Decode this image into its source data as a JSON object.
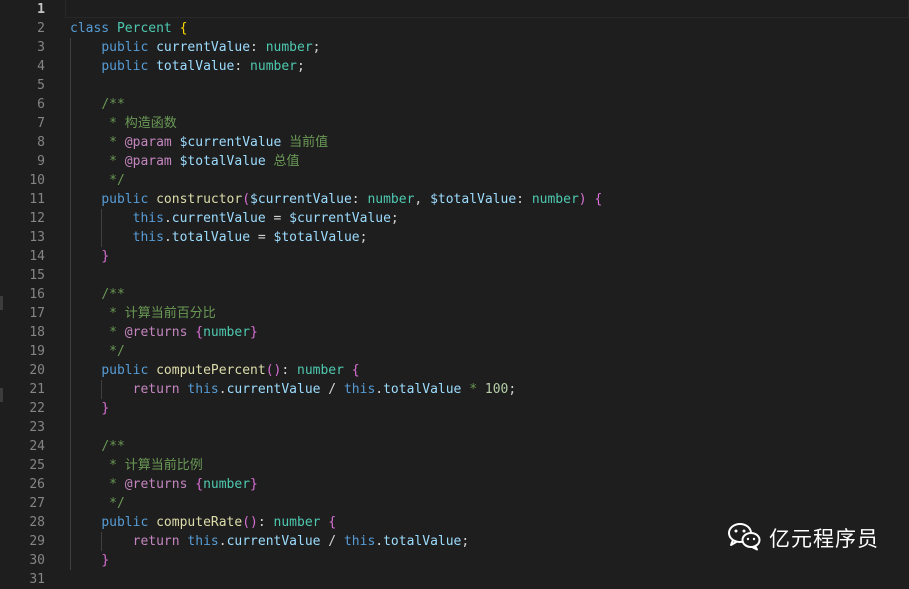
{
  "editor": {
    "active_line": "1",
    "lines": [
      {
        "n": "1"
      },
      {
        "n": "2",
        "t": [
          "class",
          " ",
          "Percent",
          " ",
          "{"
        ]
      },
      {
        "n": "3",
        "t": [
          "    ",
          "public",
          " ",
          "currentValue",
          ": ",
          "number",
          ";"
        ]
      },
      {
        "n": "4",
        "t": [
          "    ",
          "public",
          " ",
          "totalValue",
          ": ",
          "number",
          ";"
        ]
      },
      {
        "n": "5"
      },
      {
        "n": "6",
        "t": [
          "    ",
          "/**"
        ]
      },
      {
        "n": "7",
        "t": [
          "     * 构造函数"
        ]
      },
      {
        "n": "8",
        "t": [
          "     * ",
          "@param",
          " ",
          "$currentValue",
          " 当前值"
        ]
      },
      {
        "n": "9",
        "t": [
          "     * ",
          "@param",
          " ",
          "$totalValue",
          " 总值"
        ]
      },
      {
        "n": "10",
        "t": [
          "     */"
        ]
      },
      {
        "n": "11",
        "t": [
          "    ",
          "public",
          " ",
          "constructor",
          "(",
          "$currentValue",
          ": ",
          "number",
          ", ",
          "$totalValue",
          ": ",
          "number",
          ")",
          " ",
          "{"
        ]
      },
      {
        "n": "12",
        "t": [
          "        ",
          "this",
          ".",
          "currentValue",
          " = ",
          "$currentValue",
          ";"
        ]
      },
      {
        "n": "13",
        "t": [
          "        ",
          "this",
          ".",
          "totalValue",
          " = ",
          "$totalValue",
          ";"
        ]
      },
      {
        "n": "14",
        "t": [
          "    ",
          "}"
        ]
      },
      {
        "n": "15"
      },
      {
        "n": "16",
        "t": [
          "    ",
          "/**"
        ]
      },
      {
        "n": "17",
        "t": [
          "     * 计算当前百分比"
        ]
      },
      {
        "n": "18",
        "t": [
          "     * ",
          "@returns",
          " ",
          "{",
          "number",
          "}"
        ]
      },
      {
        "n": "19",
        "t": [
          "     */"
        ]
      },
      {
        "n": "20",
        "t": [
          "    ",
          "public",
          " ",
          "computePercent",
          "()",
          ": ",
          "number",
          " ",
          "{"
        ]
      },
      {
        "n": "21",
        "t": [
          "        ",
          "return",
          " ",
          "this",
          ".",
          "currentValue",
          " / ",
          "this",
          ".",
          "totalValue",
          " * ",
          "100",
          ";"
        ]
      },
      {
        "n": "22",
        "t": [
          "    ",
          "}"
        ]
      },
      {
        "n": "23"
      },
      {
        "n": "24",
        "t": [
          "    ",
          "/**"
        ]
      },
      {
        "n": "25",
        "t": [
          "     * 计算当前比例"
        ]
      },
      {
        "n": "26",
        "t": [
          "     * ",
          "@returns",
          " ",
          "{",
          "number",
          "}"
        ]
      },
      {
        "n": "27",
        "t": [
          "     */"
        ]
      },
      {
        "n": "28",
        "t": [
          "    ",
          "public",
          " ",
          "computeRate",
          "()",
          ": ",
          "number",
          " ",
          "{"
        ]
      },
      {
        "n": "29",
        "t": [
          "        ",
          "return",
          " ",
          "this",
          ".",
          "currentValue",
          " / ",
          "this",
          ".",
          "totalValue",
          ";"
        ]
      },
      {
        "n": "30",
        "t": [
          "    ",
          "}"
        ]
      },
      {
        "n": "31"
      }
    ]
  },
  "syntax_colors": {
    "background": "#1e1e1e",
    "keyword": "#569cd6",
    "control": "#c586c0",
    "class": "#4ec9b0",
    "property": "#9cdcfe",
    "function": "#dcdcaa",
    "number": "#b5cea8",
    "comment": "#6a9955"
  },
  "watermark": {
    "text": "亿元程序员",
    "icon": "wechat-icon"
  }
}
